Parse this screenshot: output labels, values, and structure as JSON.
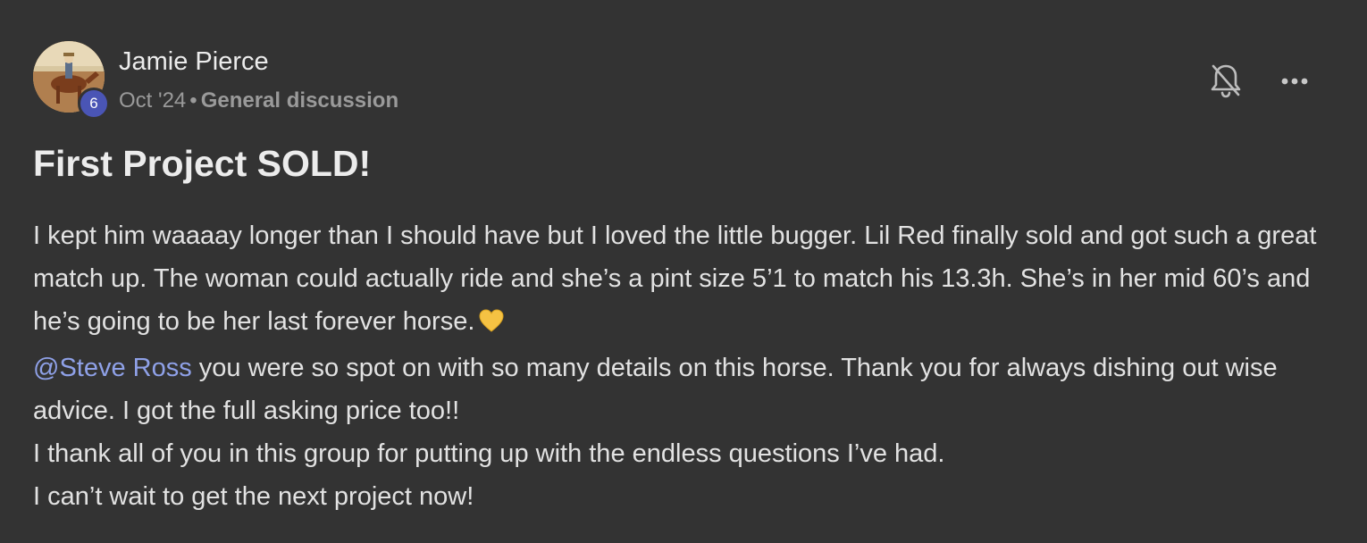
{
  "post": {
    "author": {
      "name": "Jamie Pierce",
      "level": "6"
    },
    "meta": {
      "date": "Oct '24",
      "separator": "•",
      "topic": "General discussion"
    },
    "title": "First Project SOLD!",
    "body": {
      "paragraph1": "I kept him waaaay longer than I should have but I loved the little bugger. Lil Red finally sold and got such a great match up. The woman could actually ride and she’s a pint size 5’1 to match his 13.3h. She’s in her mid 60’s and he’s going to be her last forever horse.",
      "paragraph1_emoji": "yellow-heart-icon",
      "mention": "@Steve Ross",
      "paragraph2_rest": " you were so spot on with so many details on this horse. Thank you for always dishing out wise advice. I got the full asking price too!!",
      "paragraph3": "I thank all of you in this group for putting up with the endless questions I’ve had.",
      "paragraph4": "I can’t wait to get the next project now!"
    },
    "actions": {
      "notifications_icon": "bell-off-icon",
      "more_icon": "more-options-icon"
    },
    "colors": {
      "background": "#333333",
      "mention": "#8fa1e8",
      "level_badge": "#4a55b5"
    }
  }
}
